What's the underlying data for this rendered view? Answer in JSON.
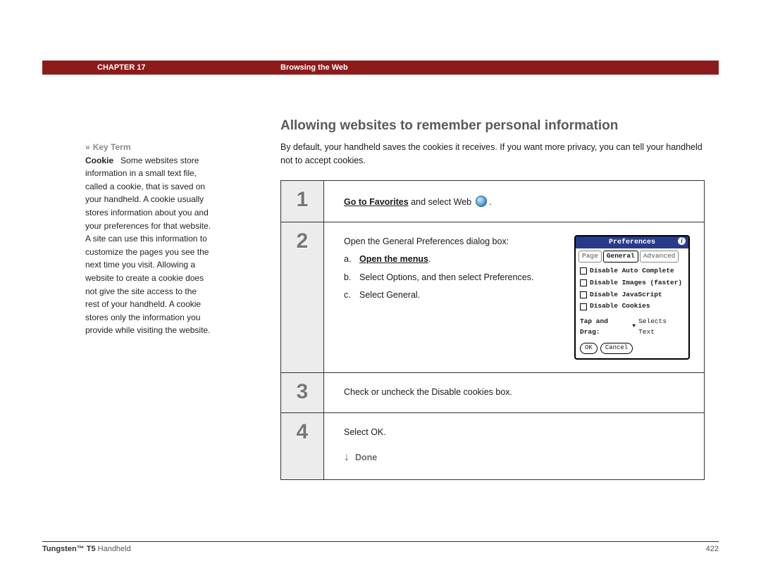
{
  "header": {
    "chapter": "CHAPTER 17",
    "title": "Browsing the Web"
  },
  "sidebar": {
    "label": "Key Term",
    "term": "Cookie",
    "definition": "Some websites store information in a small text file, called a cookie, that is saved on your handheld. A cookie usually stores information about you and your preferences for that website. A site can use this information to customize the pages you see the next time you visit. Allowing a website to create a cookie does not give the site access to the rest of your handheld. A cookie stores only the information you provide while visiting the website."
  },
  "main": {
    "heading": "Allowing websites to remember personal information",
    "intro": "By default, your handheld saves the cookies it receives. If you want more privacy, you can tell your handheld not to accept cookies."
  },
  "steps": [
    {
      "num": "1",
      "link": "Go to Favorites",
      "rest": " and select Web ",
      "has_icon": true
    },
    {
      "num": "2",
      "lead": "Open the General Preferences dialog box:",
      "sub": [
        {
          "lbl": "a.",
          "text": "Open the menus",
          "link": true,
          "suffix": "."
        },
        {
          "lbl": "b.",
          "text": "Select Options, and then select Preferences."
        },
        {
          "lbl": "c.",
          "text": "Select General."
        }
      ],
      "prefs": {
        "title": "Preferences",
        "tabs": [
          "Page",
          "General",
          "Advanced"
        ],
        "active_tab": 1,
        "items": [
          "Disable Auto Complete",
          "Disable Images (faster)",
          "Disable JavaScript",
          "Disable Cookies"
        ],
        "tap_label": "Tap and Drag:",
        "tap_value": "Selects Text",
        "buttons": [
          "OK",
          "Cancel"
        ]
      }
    },
    {
      "num": "3",
      "plain": "Check or uncheck the Disable cookies box."
    },
    {
      "num": "4",
      "plain": "Select OK.",
      "done": "Done"
    }
  ],
  "footer": {
    "product_bold": "Tungsten™ T5",
    "product_rest": " Handheld",
    "page": "422"
  }
}
